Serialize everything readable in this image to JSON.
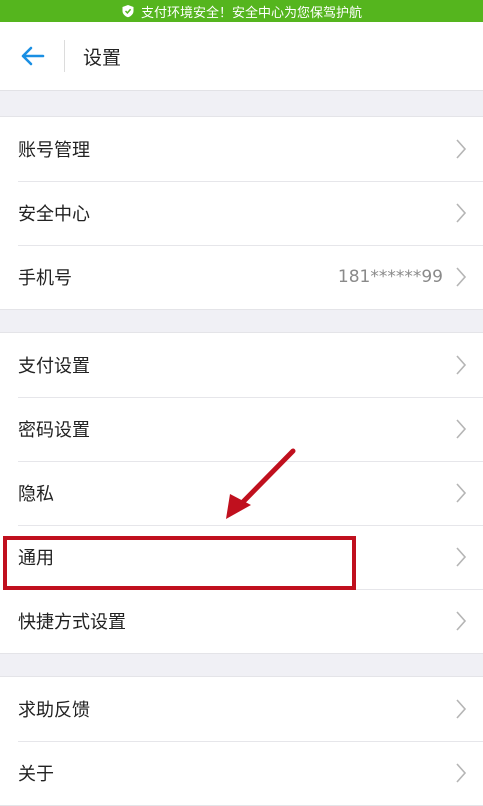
{
  "banner": {
    "text": "支付环境安全！安全中心为您保驾护航",
    "color": "#55b51e",
    "icon": "shield-icon"
  },
  "header": {
    "title": "设置",
    "back_icon": "arrow-left-icon"
  },
  "groups": [
    {
      "items": [
        {
          "label": "账号管理",
          "value": ""
        },
        {
          "label": "安全中心",
          "value": ""
        },
        {
          "label": "手机号",
          "value": "181******99"
        }
      ]
    },
    {
      "items": [
        {
          "label": "支付设置",
          "value": ""
        },
        {
          "label": "密码设置",
          "value": ""
        },
        {
          "label": "隐私",
          "value": ""
        },
        {
          "label": "通用",
          "value": ""
        },
        {
          "label": "快捷方式设置",
          "value": ""
        }
      ]
    },
    {
      "items": [
        {
          "label": "求助反馈",
          "value": ""
        },
        {
          "label": "关于",
          "value": ""
        }
      ]
    }
  ],
  "annotation": {
    "target": "通用",
    "color": "#c0101e"
  }
}
